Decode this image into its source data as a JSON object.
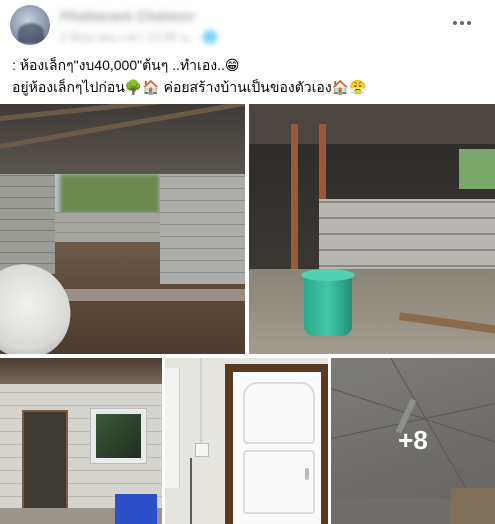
{
  "post": {
    "author_name": "Phattanant Chaiwon",
    "meta": "2 มิถุนายน เวลา 12:00 น. · 🌐"
  },
  "caption": {
    "line1": ": ห้องเล็กๆ\"งบ40,000\"ต้นๆ ..ทำเอง..😁",
    "line2": "อยู่ห้องเล็กๆไปก่อน🌳🏠 ค่อยสร้างบ้านเป็นของตัวเอง🏠😤"
  },
  "gallery": {
    "more_count": "+8"
  },
  "icons": {
    "more": "more-horizontal-icon"
  }
}
